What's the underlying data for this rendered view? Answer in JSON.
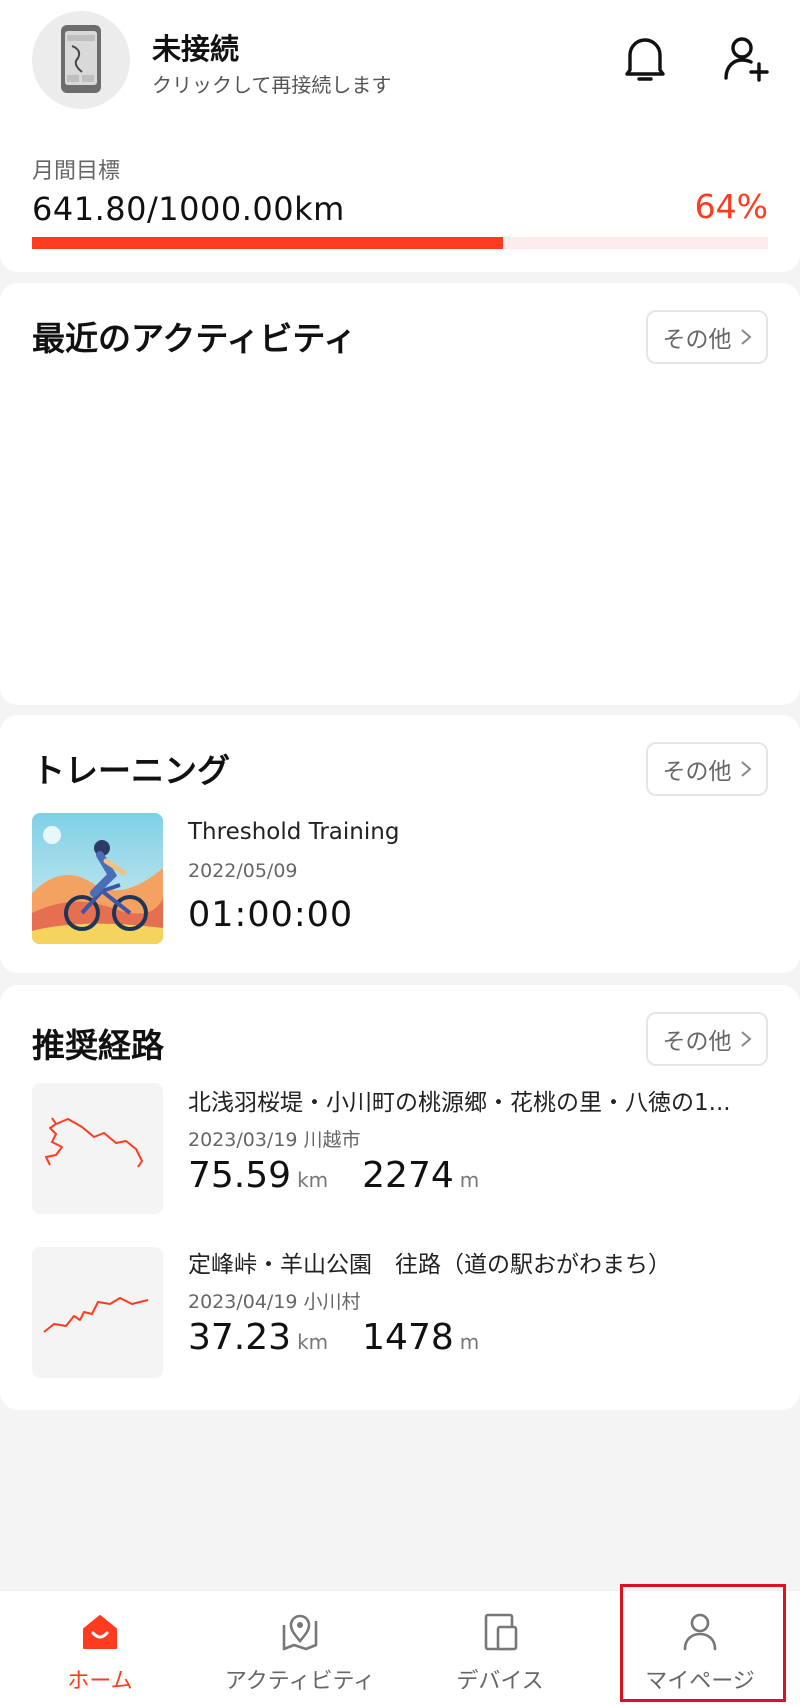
{
  "header": {
    "device_status": "未接続",
    "device_subtitle": "クリックして再接続します",
    "icons": [
      "device-image",
      "bell-icon",
      "add-user-icon"
    ]
  },
  "monthly_goal": {
    "label": "月間目標",
    "value_text": "641.80/1000.00km",
    "percent_text": "64%",
    "progress": 0.64,
    "accent_color": "#ff3b1f"
  },
  "recent_activity": {
    "title": "最近のアクティビティ",
    "more_label": "その他"
  },
  "training": {
    "title": "トレーニング",
    "more_label": "その他",
    "item": {
      "name": "Threshold Training",
      "date": "2022/05/09",
      "duration": "01:00:00"
    }
  },
  "routes": {
    "title": "推奨経路",
    "more_label": "その他",
    "items": [
      {
        "name": "北浅羽桜堤・小川町の桃源郷・花桃の里・八徳の1...",
        "meta": "2023/03/19 川越市",
        "distance": "75.59",
        "distance_unit": "km",
        "elevation": "2274",
        "elevation_unit": "m"
      },
      {
        "name": "定峰峠・羊山公園　往路（道の駅おがわまち）",
        "meta": "2023/04/19 小川村",
        "distance": "37.23",
        "distance_unit": "km",
        "elevation": "1478",
        "elevation_unit": "m"
      }
    ]
  },
  "nav": {
    "items": [
      {
        "label": "ホーム",
        "icon": "home-icon",
        "active": true
      },
      {
        "label": "アクティビティ",
        "icon": "map-pin-icon",
        "active": false
      },
      {
        "label": "デバイス",
        "icon": "devices-icon",
        "active": false
      },
      {
        "label": "マイページ",
        "icon": "person-icon",
        "active": false
      }
    ]
  }
}
